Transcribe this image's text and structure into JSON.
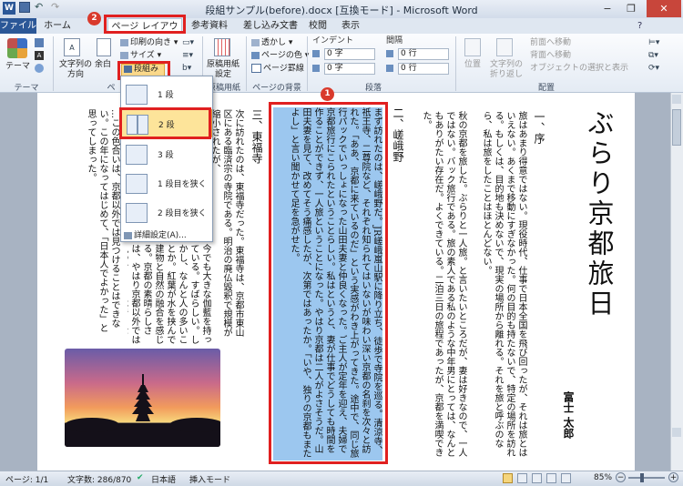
{
  "window": {
    "title": "段組サンプル(before).docx [互換モード] - Microsoft Word",
    "min": "−",
    "max": "❐",
    "close": "✕"
  },
  "tabs": [
    "ファイル",
    "ホーム",
    "ページ レイアウト",
    "参考資料",
    "差し込み文書",
    "校閲",
    "表示"
  ],
  "ribbon": {
    "theme": "テーマ",
    "text_direction": "文字列の\n方向",
    "margin": "余白",
    "orientation": "印刷の向き",
    "size": "サイズ",
    "columns": "段組み",
    "manuscript": "原稿用紙\n設定",
    "watermark": "透かし",
    "page_color": "ページの色",
    "page_border": "ページ罫線",
    "indent": "インデント",
    "spacing": "間隔",
    "indent_left": "0 字",
    "indent_right": "0 字",
    "spacing_before": "0 行",
    "spacing_after": "0 行",
    "position": "位置",
    "wrap": "文字列の\n折り返し",
    "bring_forward": "前面へ移動",
    "send_backward": "背面へ移動",
    "selection_pane": "オブジェクトの選択と表示",
    "groups": {
      "theme": "テーマ",
      "page_setup": "ペ",
      "manuscript": "原稿用紙",
      "page_bg": "ページの背景",
      "paragraph": "段落",
      "arrange": "配置"
    }
  },
  "dropdown": {
    "options": [
      "1 段",
      "2 段",
      "3 段",
      "1 段目を狭く",
      "2 段目を狭く"
    ],
    "more": "詳細設定(A)..."
  },
  "markers": {
    "one": "1",
    "two": "2"
  },
  "document": {
    "title": "ぶらり京都旅日記",
    "author": "富士 太郎",
    "sec1_heading": "一、序",
    "sec1_body": "旅はあまり得意ではない。現役時代、仕事で日本全国を飛び回ったが、それは旅とはいえない。あくまで移動にすぎなかった。何の目的も持たないで、特定の場所を訪れる。もしくは、目的地も決めないで、現実の場所から離れる。それを旅と呼ぶのなら、私は旅をしたことはほとんどない。",
    "sec1_body2": "秋の京都を旅した。ぶらりと一人旅。と言いたいところだが、妻は好きなので、一人ではない。バック旅行である。旅の素人である私のような中年男にとっては、なんともありがたい存在だ。よくできている。二泊三日の旅程であったが、京都を満喫できた。",
    "sec2_heading": "二、嵯峨野",
    "sec2_body": "まず訪れたのは、嵯峨野だ。JR嵯峨嵐山駅に降り立ち、徒歩で寺院を巡る。清涼寺、祇王寺、二尊院など、それぞれ知られてはいないが味わい深い京都の名刹を次々と訪れた。「ああ、京都に来ているのだ」という実感がわき上がってきた。途中で、同じ旅行パックでいっしょになった山田夫妻と仲良くなった。ご主人が定年を迎え、夫婦で京都旅行にこられたということらしい。私はというと、妻が仕事でどうしても時間を作ることができず、一人旅ということになった。やはり京都は二人がよさそうだ。山田夫妻を見て、改めてそう痛感したが、次第ではあったか。「いや、独りの京都もまたよし」と言い聞かせて足を急がせた。",
    "sec3_heading": "三、東福寺",
    "sec3_body": "次に訪れたのは、東福寺だった。東福寺は、京都市東山区にある臨済宗の寺院である。明治の廃仏毀釈で規模が縮小されたが、",
    "sec3_body2": "今でも大きな伽藍を持っている。すばらしい。しかし、なんと人の多いことか。紅葉が水を挟んで広がる景観は、",
    "sec3_body3": "建物と自然の融合を感じる。京都の素晴らしさは、やはり京都以外では見つけることはできない。この年になって",
    "sec3_body4": "…この色合いは、京都以外では見つけることはできない。この年になってはじめて、「日本人でよかった」と思ってしまった。"
  },
  "status": {
    "page": "ページ: 1/1",
    "words": "文字数: 286/870",
    "lang": "日本語",
    "mode": "挿入モード",
    "zoom": "85%"
  }
}
